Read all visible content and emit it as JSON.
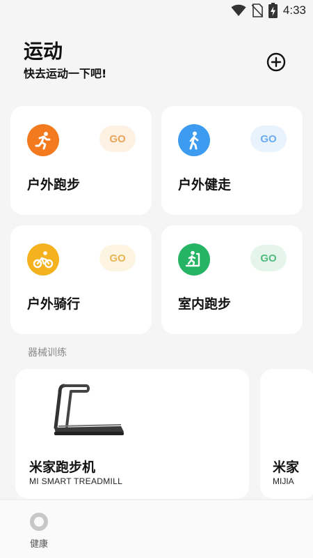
{
  "status": {
    "time": "4:33",
    "icons": [
      "wifi-icon",
      "no-sim-icon",
      "battery-charging-icon"
    ]
  },
  "header": {
    "title": "运动",
    "subtitle": "快去运动一下吧!",
    "add_icon": "plus-circle-icon"
  },
  "sports": [
    {
      "label": "户外跑步",
      "go": "GO",
      "icon": "running-icon",
      "color": "#f47a1f",
      "go_bg": "#fdf1e3",
      "go_color": "#e8a45a"
    },
    {
      "label": "户外健走",
      "go": "GO",
      "icon": "walking-icon",
      "color": "#3d9bf0",
      "go_bg": "#e8f3fd",
      "go_color": "#6aacf0"
    },
    {
      "label": "户外骑行",
      "go": "GO",
      "icon": "cycling-icon",
      "color": "#f5b21f",
      "go_bg": "#fdf5e2",
      "go_color": "#e7b552"
    },
    {
      "label": "室内跑步",
      "go": "GO",
      "icon": "treadmill-running-icon",
      "color": "#25b464",
      "go_bg": "#e5f5ec",
      "go_color": "#4fba7d"
    }
  ],
  "equipment": {
    "section_title": "器械训练",
    "items": [
      {
        "name": "米家跑步机",
        "subtitle": "MI SMART TREADMILL"
      },
      {
        "name": "米家",
        "subtitle": "MIJIA"
      }
    ]
  },
  "nav": {
    "items": [
      {
        "label": "健康",
        "icon": "health-ring-icon"
      }
    ]
  }
}
